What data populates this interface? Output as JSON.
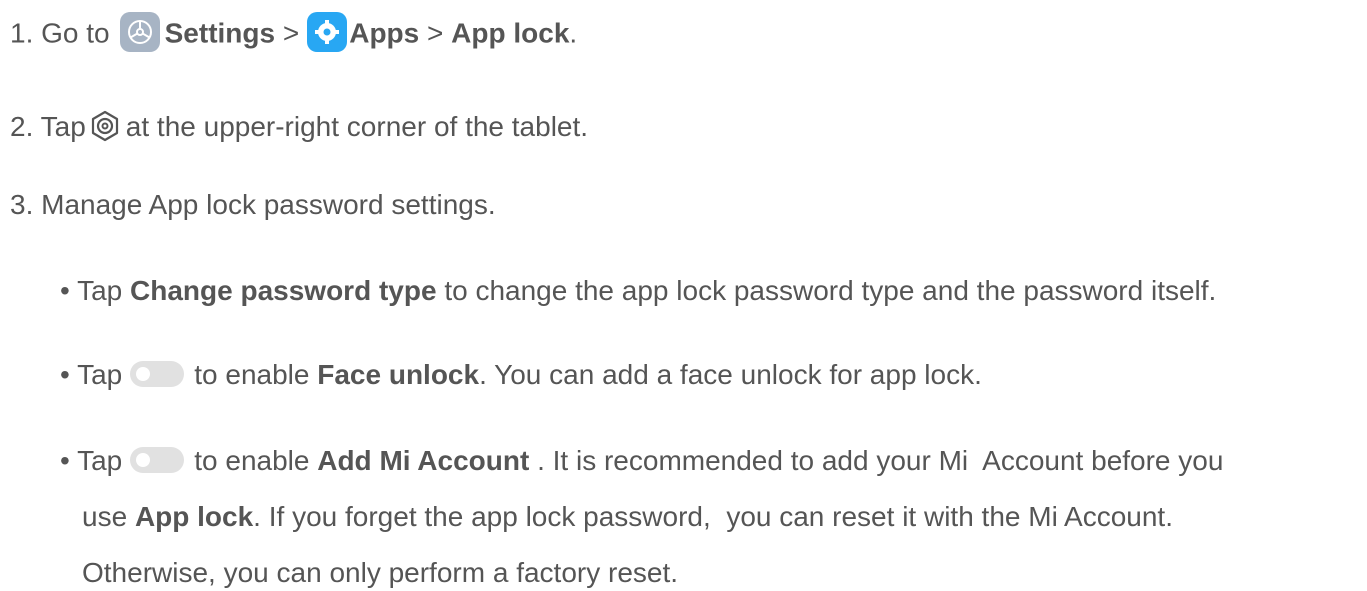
{
  "step1": {
    "prefix": "1. Go to",
    "settings": "Settings",
    "sep1": ">",
    "apps": "Apps",
    "sep2": ">",
    "applock": "App lock",
    "end": "."
  },
  "step2": {
    "prefix": "2. Tap",
    "rest": "at the upper-right corner of the tablet."
  },
  "step3": {
    "text": "3. Manage App lock password settings."
  },
  "bullet1": {
    "prefix": "• Tap",
    "bold": "Change password type",
    "rest": "to change the app lock password type and the password itself."
  },
  "bullet2": {
    "prefix": "• Tap",
    "mid": "to enable",
    "bold": "Face unlock",
    "rest": ". You can add a face unlock for app lock."
  },
  "bullet3": {
    "prefix": "• Tap",
    "mid": "to enable",
    "bold": "Add Mi Account",
    "rest": " . It is recommended to add your Mi  Account before you",
    "line2_pre": "use",
    "line2_bold": "App lock",
    "line2_rest": ". If you forget the app lock password,  you can reset it with the Mi Account.",
    "line3": "Otherwise, you can only perform a factory reset."
  },
  "colors": {
    "text": "#555555",
    "settings_icon_bg": "#a7b4c4",
    "apps_icon_bg": "#28a7f3",
    "toggle_off": "#e1e1e1"
  },
  "icons": [
    "settings-app-icon",
    "apps-app-icon",
    "gear-ring-icon",
    "toggle-switch-icon"
  ]
}
